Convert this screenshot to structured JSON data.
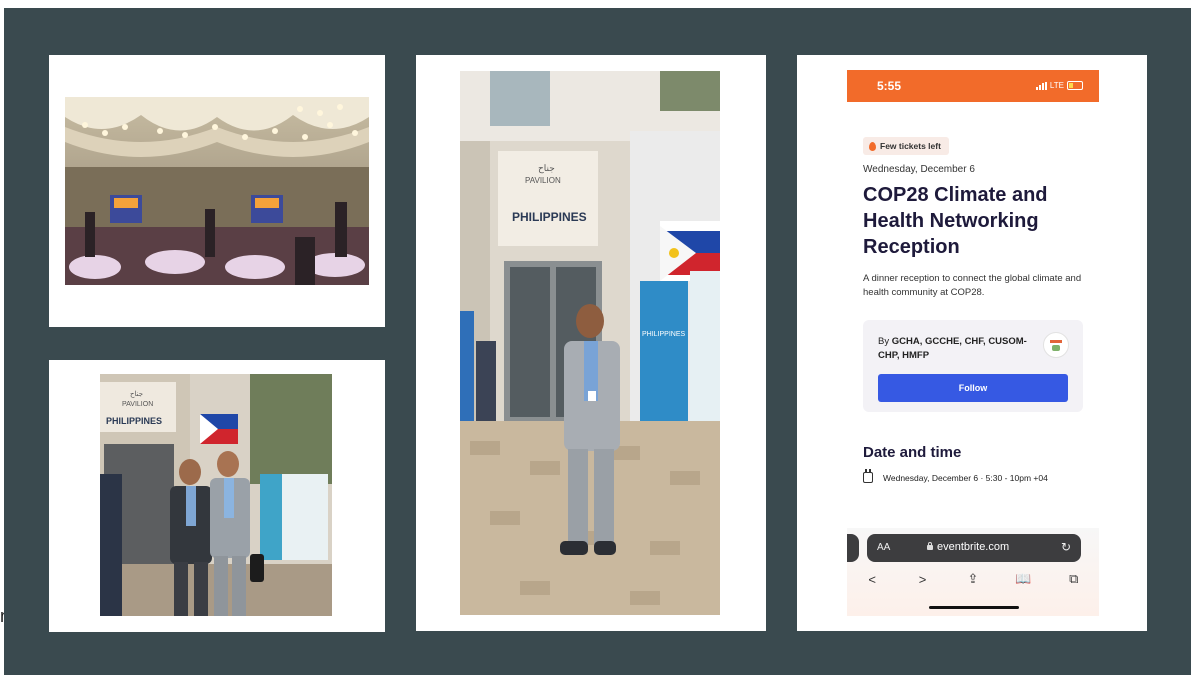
{
  "caption_fragment": "n",
  "phone": {
    "status": {
      "time": "5:55",
      "network": "LTE"
    },
    "badge": "Few tickets left",
    "date": "Wednesday, December 6",
    "title": "COP28 Climate and Health Networking Reception",
    "description": "A dinner reception to connect the global climate and health community at COP28.",
    "organizer": {
      "by": "By",
      "names": "GCHA, GCCHE, CHF, CUSOM-CHP, HMFP",
      "follow_label": "Follow"
    },
    "date_time": {
      "heading": "Date and time",
      "value": "Wednesday, December 6 · 5:30 - 10pm +04"
    },
    "browser": {
      "aa": "AA",
      "url": "eventbrite.com",
      "nav": {
        "back": "<",
        "forward": ">",
        "share": "⇪",
        "bookmarks": "📖",
        "tabs": "⧉"
      }
    }
  },
  "photos": {
    "pavilion_sign": "PAVILION",
    "pavilion_sign_arabic": "جناح",
    "country_sign": "PHILIPPINES",
    "banner_text": "PHILIPPINES"
  },
  "colors": {
    "board": "#3a4a4f",
    "status_bar": "#f26b2a",
    "follow_button": "#3659e3",
    "title": "#1e1a3b"
  }
}
